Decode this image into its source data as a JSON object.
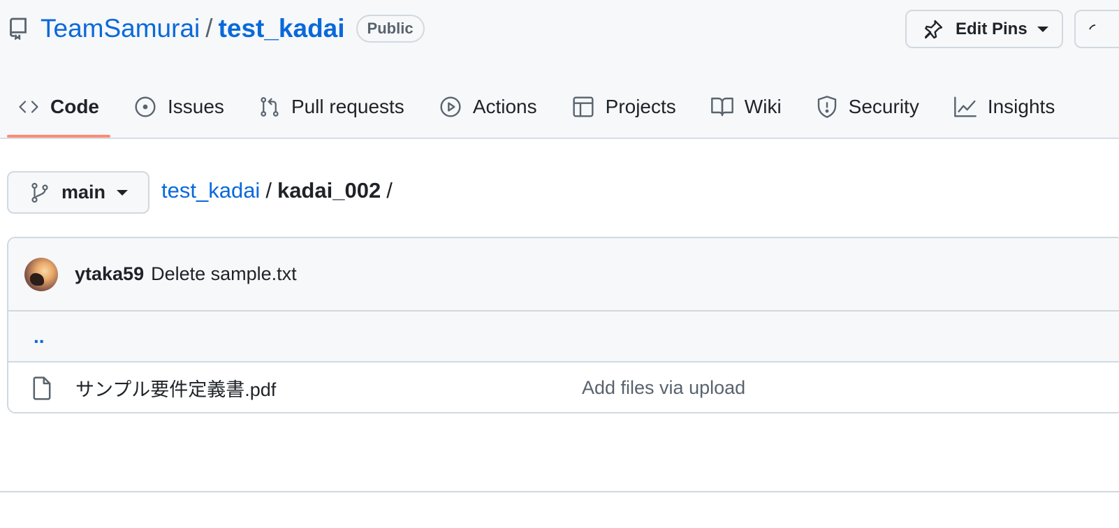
{
  "repo": {
    "owner": "TeamSamurai",
    "separator": "/",
    "name": "test_kadai",
    "visibility": "Public"
  },
  "actions": {
    "edit_pins_label": "Edit Pins"
  },
  "tabs": [
    {
      "label": "Code",
      "icon": "code-icon",
      "selected": true
    },
    {
      "label": "Issues",
      "icon": "issue-icon"
    },
    {
      "label": "Pull requests",
      "icon": "pull-request-icon"
    },
    {
      "label": "Actions",
      "icon": "play-icon"
    },
    {
      "label": "Projects",
      "icon": "table-icon"
    },
    {
      "label": "Wiki",
      "icon": "book-icon"
    },
    {
      "label": "Security",
      "icon": "shield-icon"
    },
    {
      "label": "Insights",
      "icon": "graph-icon"
    }
  ],
  "branch": {
    "name": "main"
  },
  "breadcrumb": {
    "root": "test_kadai",
    "separator": "/",
    "current": "kadai_002",
    "trailing": "/"
  },
  "commit": {
    "author": "ytaka59",
    "message": "Delete sample.txt"
  },
  "parent_dir": {
    "label": ".."
  },
  "files": [
    {
      "name": "サンプル要件定義書.pdf",
      "commit_message": "Add files via upload",
      "icon": "file-icon"
    }
  ],
  "colors": {
    "link": "#0969da",
    "tab_underline": "#fd8c73",
    "header_bg": "#f6f8fa",
    "border": "#d1d9e0"
  }
}
